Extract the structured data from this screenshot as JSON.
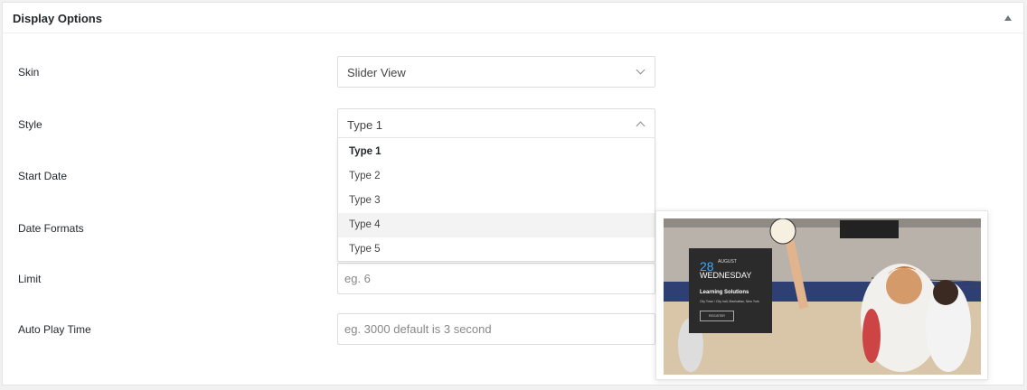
{
  "panel": {
    "title": "Display Options"
  },
  "fields": {
    "skin": {
      "label": "Skin",
      "value": "Slider View"
    },
    "style": {
      "label": "Style",
      "value": "Type 1"
    },
    "start_date": {
      "label": "Start Date"
    },
    "date_formats": {
      "label": "Date Formats"
    },
    "limit": {
      "label": "Limit",
      "placeholder": "eg. 6"
    },
    "auto_play": {
      "label": "Auto Play Time",
      "placeholder": "eg. 3000 default is 3 second"
    }
  },
  "style_options": [
    "Type 1",
    "Type 2",
    "Type 3",
    "Type 4",
    "Type 5"
  ],
  "style_selected": "Type 1",
  "style_hovered": "Type 4",
  "preview": {
    "day": "28",
    "month": "AUGUST",
    "weekday": "WEDNESDAY",
    "title": "Learning Solutions",
    "location": "City Town / City hall, Manhattan, New York",
    "button": "REGISTER"
  },
  "colors": {
    "accent": "#3ea8ff",
    "card": "#2b2b2b"
  }
}
